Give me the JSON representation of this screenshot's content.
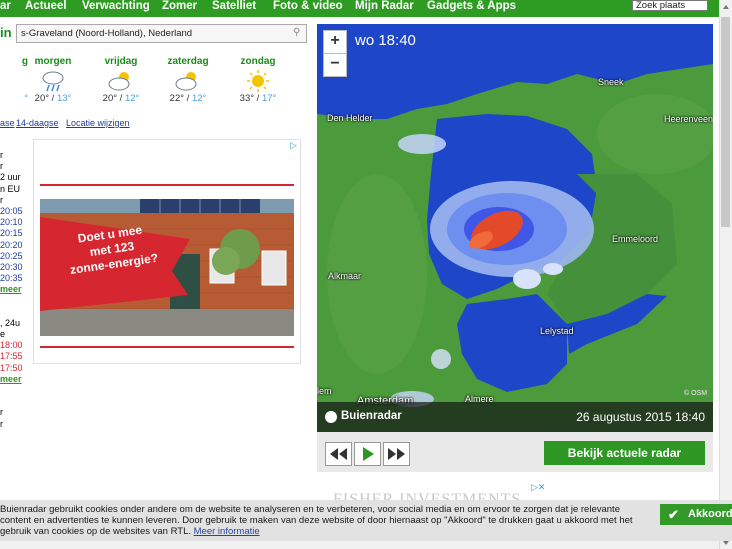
{
  "nav": {
    "items": [
      "ar",
      "Actueel",
      "Verwachting",
      "Zomer",
      "Satelliet",
      "Foto & video",
      "Mijn Radar",
      "Gadgets & Apps"
    ],
    "search_placeholder": "Zoek plaats"
  },
  "location": {
    "title": "in",
    "value": "s-Graveland (Noord-Holland), Nederland"
  },
  "forecast": [
    {
      "day": "g",
      "high": "",
      "low": "°"
    },
    {
      "day": "morgen",
      "icon": "rain-cloud-icon",
      "high": "20°",
      "low": "13°"
    },
    {
      "day": "vrijdag",
      "icon": "partly-cloudy-icon",
      "high": "20°",
      "low": "12°"
    },
    {
      "day": "zaterdag",
      "icon": "partly-cloudy-icon",
      "high": "22°",
      "low": "12°"
    },
    {
      "day": "zondag",
      "icon": "sun-icon",
      "high": "33°",
      "low": "17°"
    }
  ],
  "links": [
    "ase",
    "14-daagse",
    "Locatie wijzigen"
  ],
  "left_column": [
    "r",
    "r",
    "2 uur",
    "n EU",
    "r",
    "20:05",
    "20:10",
    "20:15",
    "20:20",
    "20:25",
    "20:30",
    "20:35",
    "meer",
    "",
    "",
    ", 24u",
    "e",
    "18:00",
    "17:55",
    "17:50",
    "meer",
    "",
    "",
    "r",
    "r"
  ],
  "ad": {
    "banner_line1": "Doet u mee",
    "banner_line2": "met 123",
    "banner_line3": "zonne-energie?"
  },
  "radar": {
    "zoom_in": "+",
    "zoom_out": "−",
    "time": "wo 18:40",
    "cities": [
      "Den Helder",
      "Sneek",
      "Heerenveen",
      "Emmeloord",
      "Alkmaar",
      "Lelystad",
      "Amsterdam",
      "Almere",
      "lem"
    ],
    "brand": "Buienradar",
    "date": "26 augustus 2015 18:40",
    "attribution": "© OSM",
    "button": "Bekijk actuele radar"
  },
  "ad2": {
    "text": "FISHER INVESTMENTS"
  },
  "cookie": {
    "text": "Buienradar gebruikt cookies onder andere om de website te analyseren en te verbeteren, voor social media en om ervoor te zorgen dat je relevante content en advertenties te kunnen leveren. Door gebruik te maken van deze website of door hiernaast op \"Akkoord\" te drukken gaat u akkoord met het gebruik van cookies op de websites van RTL.",
    "link": "Meer informatie",
    "button": "Akkoord"
  },
  "colors": {
    "brand_green": "#2d9724",
    "link_blue": "#1c3f9a",
    "map_water": "#1e46c8",
    "map_land": "#4a9a3c"
  }
}
